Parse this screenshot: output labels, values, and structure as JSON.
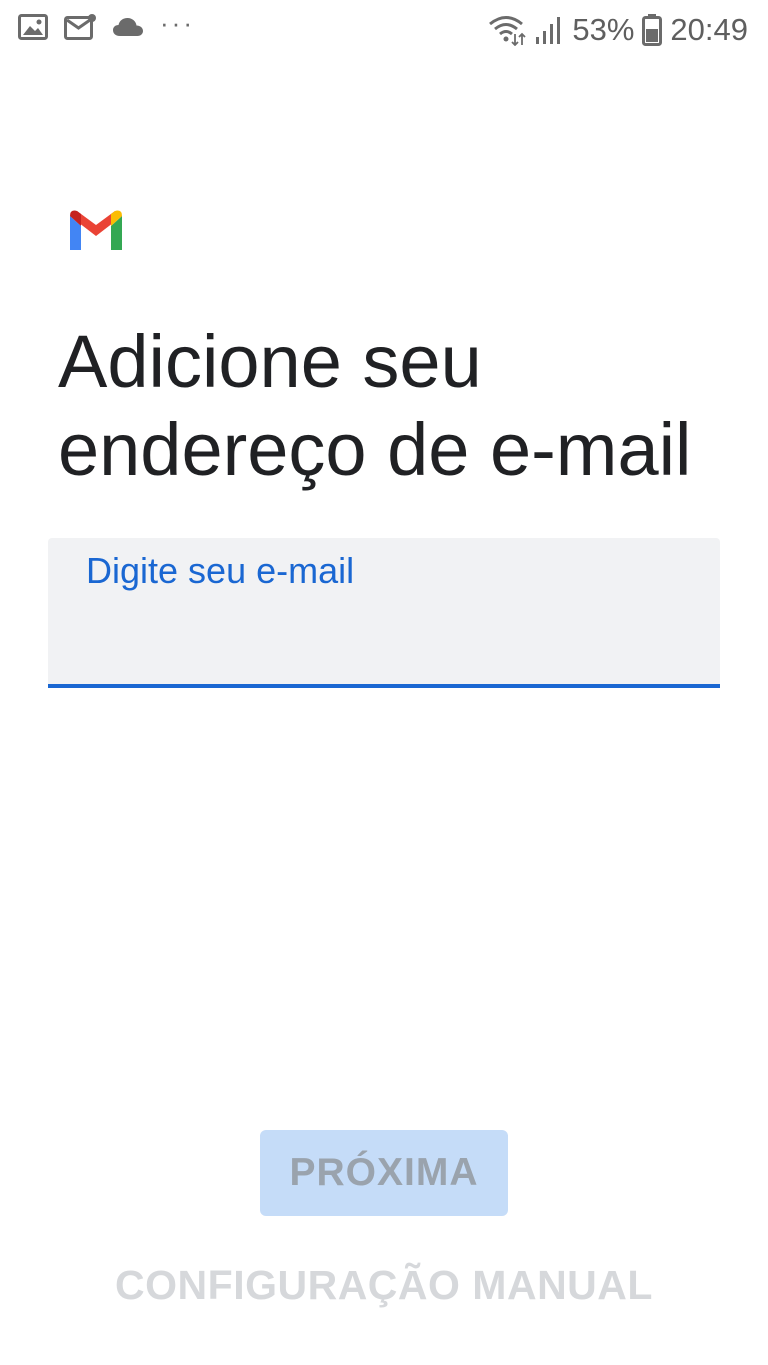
{
  "status_bar": {
    "notification_icons": [
      "gallery-icon",
      "mail-icon",
      "cloud-icon"
    ],
    "more_indicator": "···",
    "battery_percent": "53%",
    "time": "20:49"
  },
  "app": {
    "logo": "gmail-logo"
  },
  "main": {
    "title": "Adicione seu endereço de e-mail",
    "email_field": {
      "label": "Digite seu e-mail",
      "value": ""
    },
    "next_button_label": "PRÓXIMA",
    "manual_config_label": "CONFIGURAÇÃO MANUAL"
  },
  "colors": {
    "accent": "#1a67d2",
    "field_bg": "#f1f2f4",
    "button_disabled_bg": "#c5dcf8",
    "button_disabled_text": "#9aa3ad",
    "title_text": "#202124"
  }
}
